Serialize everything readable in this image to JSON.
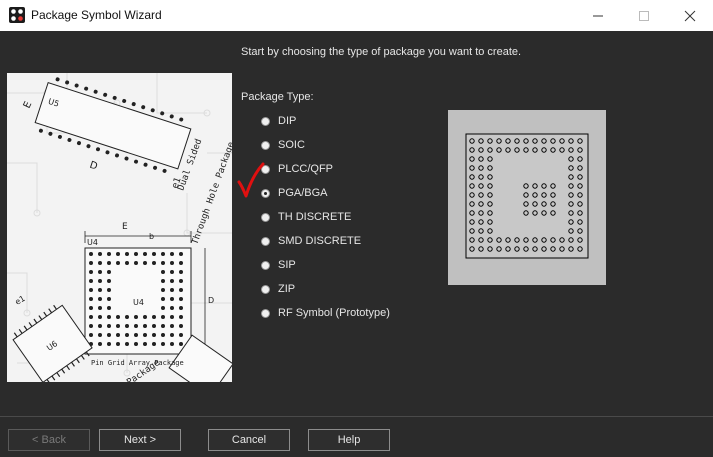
{
  "window": {
    "title": "Package Symbol Wizard",
    "controls": [
      "minimize-icon",
      "maximize-icon",
      "close-icon"
    ]
  },
  "intro_text": "Start by choosing the type of package you want to create.",
  "package_type": {
    "label": "Package Type:",
    "options": [
      {
        "label": "DIP",
        "checked": false
      },
      {
        "label": "SOIC",
        "checked": false
      },
      {
        "label": "PLCC/QFP",
        "checked": false
      },
      {
        "label": "PGA/BGA",
        "checked": true
      },
      {
        "label": "TH DISCRETE",
        "checked": false
      },
      {
        "label": "SMD DISCRETE",
        "checked": false
      },
      {
        "label": "SIP",
        "checked": false
      },
      {
        "label": "ZIP",
        "checked": false
      },
      {
        "label": "RF Symbol (Prototype)",
        "checked": false
      }
    ],
    "selected": "PGA/BGA"
  },
  "side_image": {
    "labels": {
      "pin_grid": "Pin Grid Array Package",
      "dual_sided": "Dual Sided",
      "through_hole": "Through Hole Package",
      "flat_package": "Flat Package",
      "u4": "U4",
      "u5": "U5",
      "u6": "U6",
      "e": "E",
      "e1": "e1",
      "d": "D",
      "b": "b"
    }
  },
  "colors": {
    "background": "#2b2b2b",
    "titlebar": "#ffffff",
    "annotation": "#e01010",
    "preview_bg": "#c0c0c0"
  },
  "buttons": {
    "back": "< Back",
    "next": "Next >",
    "cancel": "Cancel",
    "help": "Help"
  }
}
